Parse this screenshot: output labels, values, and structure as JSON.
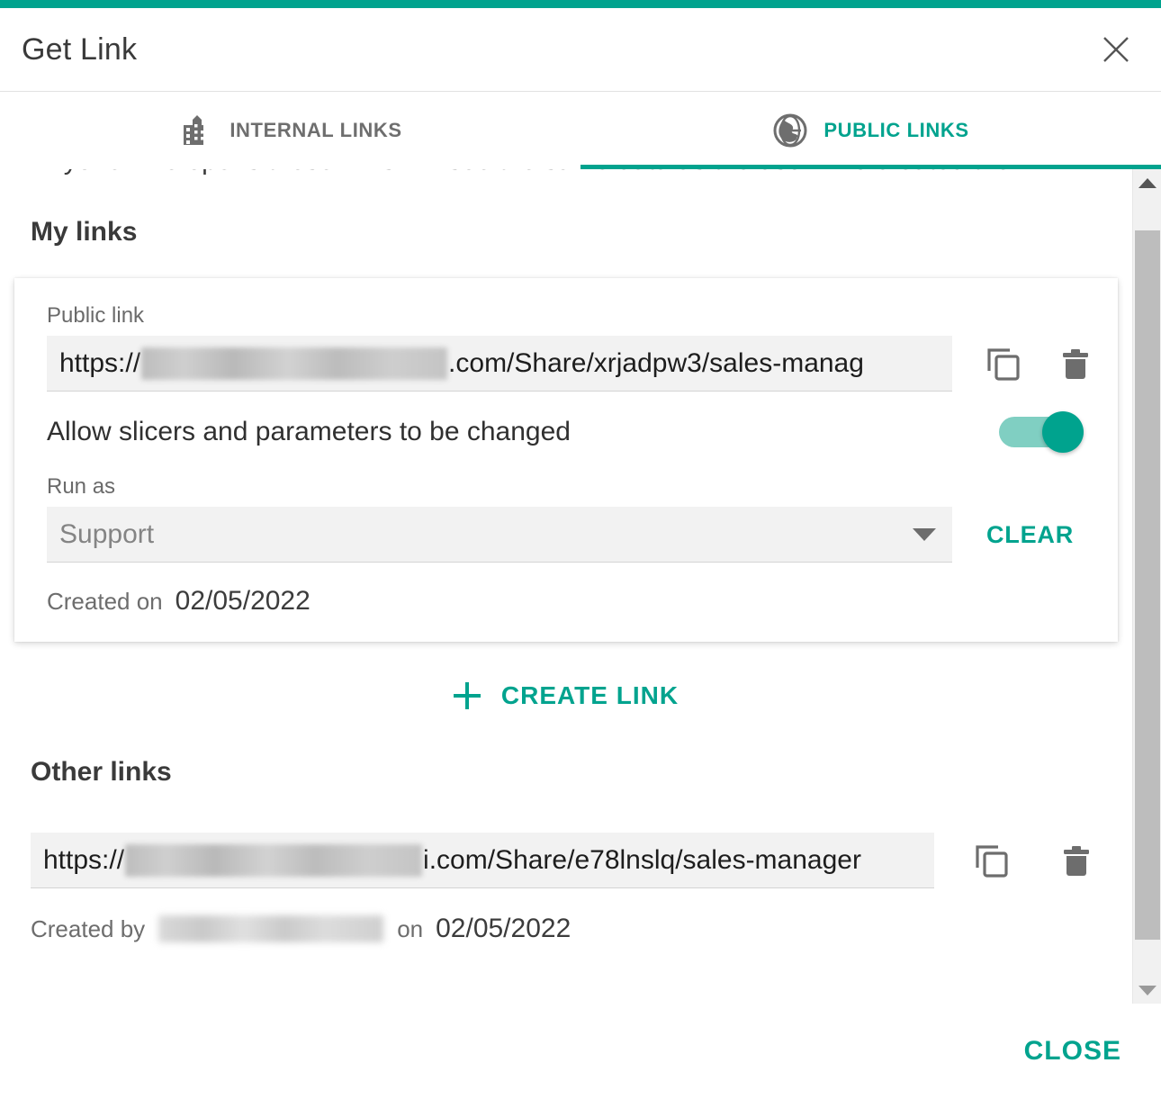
{
  "theme": {
    "accent": "#00a38e",
    "text_primary": "#3a3a3a",
    "text_muted": "#6d6d6d",
    "input_bg": "#f2f2f2"
  },
  "header": {
    "title": "Get Link",
    "close_icon": "close-icon"
  },
  "tabs": [
    {
      "label": "INTERNAL LINKS",
      "icon": "building-icon",
      "active": false
    },
    {
      "label": "PUBLIC LINKS",
      "icon": "globe-icon",
      "active": true
    }
  ],
  "intro": {
    "text": "Anyone who opens these links will see the same data as the user who created the link."
  },
  "my_links": {
    "title": "My links",
    "card": {
      "link_label": "Public link",
      "url_prefix": "https://",
      "url_suffix": ".com/Share/xrjadpw3/sales-manag",
      "url_redacted": true,
      "copy_icon": "copy-icon",
      "delete_icon": "trash-icon",
      "toggle_label": "Allow slicers and parameters to be changed",
      "toggle_on": true,
      "run_as_label": "Run as",
      "run_as_value": "Support",
      "clear_label": "CLEAR",
      "created_on_label": "Created on",
      "created_on_value": "02/05/2022"
    }
  },
  "create_link": {
    "label": "CREATE LINK",
    "plus_icon": "plus-icon"
  },
  "other_links": {
    "title": "Other links",
    "rows": [
      {
        "url_prefix": "https://",
        "url_suffix": "i.com/Share/e78lnslq/sales-manager",
        "url_redacted": true,
        "copy_icon": "copy-icon",
        "delete_icon": "trash-icon",
        "created_by_label": "Created by",
        "created_by_value_redacted": true,
        "on_label": "on",
        "created_on_value": "02/05/2022"
      }
    ]
  },
  "scrollbar": {
    "up_icon": "chevron-up-icon",
    "down_icon": "chevron-down-icon"
  },
  "footer": {
    "close_label": "CLOSE"
  }
}
